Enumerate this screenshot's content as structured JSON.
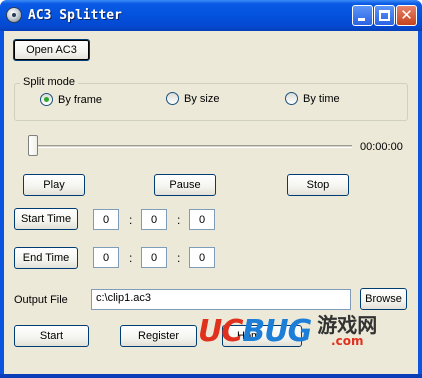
{
  "window": {
    "title": "AC3 Splitter",
    "controls": {
      "minimize": "",
      "maximize": "",
      "close": "✕"
    }
  },
  "toolbar": {
    "open_label": "Open AC3"
  },
  "split_mode": {
    "label": "Split mode",
    "options": [
      {
        "label": "By frame",
        "checked": true
      },
      {
        "label": "By size",
        "checked": false
      },
      {
        "label": "By time",
        "checked": false
      }
    ]
  },
  "player": {
    "position_fraction": 0,
    "time_display": "00:00:00",
    "play_label": "Play",
    "pause_label": "Pause",
    "stop_label": "Stop"
  },
  "start_time": {
    "label": "Start Time",
    "h": "0",
    "m": "0",
    "s": "0"
  },
  "end_time": {
    "label": "End Time",
    "h": "0",
    "m": "0",
    "s": "0"
  },
  "output": {
    "label": "Output File",
    "value": "c:\\clip1.ac3",
    "browse_label": "Browse"
  },
  "actions": {
    "start_label": "Start",
    "register_label": "Register",
    "homepage_label": "Hom"
  },
  "time_separator": ":",
  "watermark": {
    "logo_part1": "UC",
    "logo_part2": "BUG",
    "cn_top": "游戏网",
    "cn_bottom": ".com"
  }
}
